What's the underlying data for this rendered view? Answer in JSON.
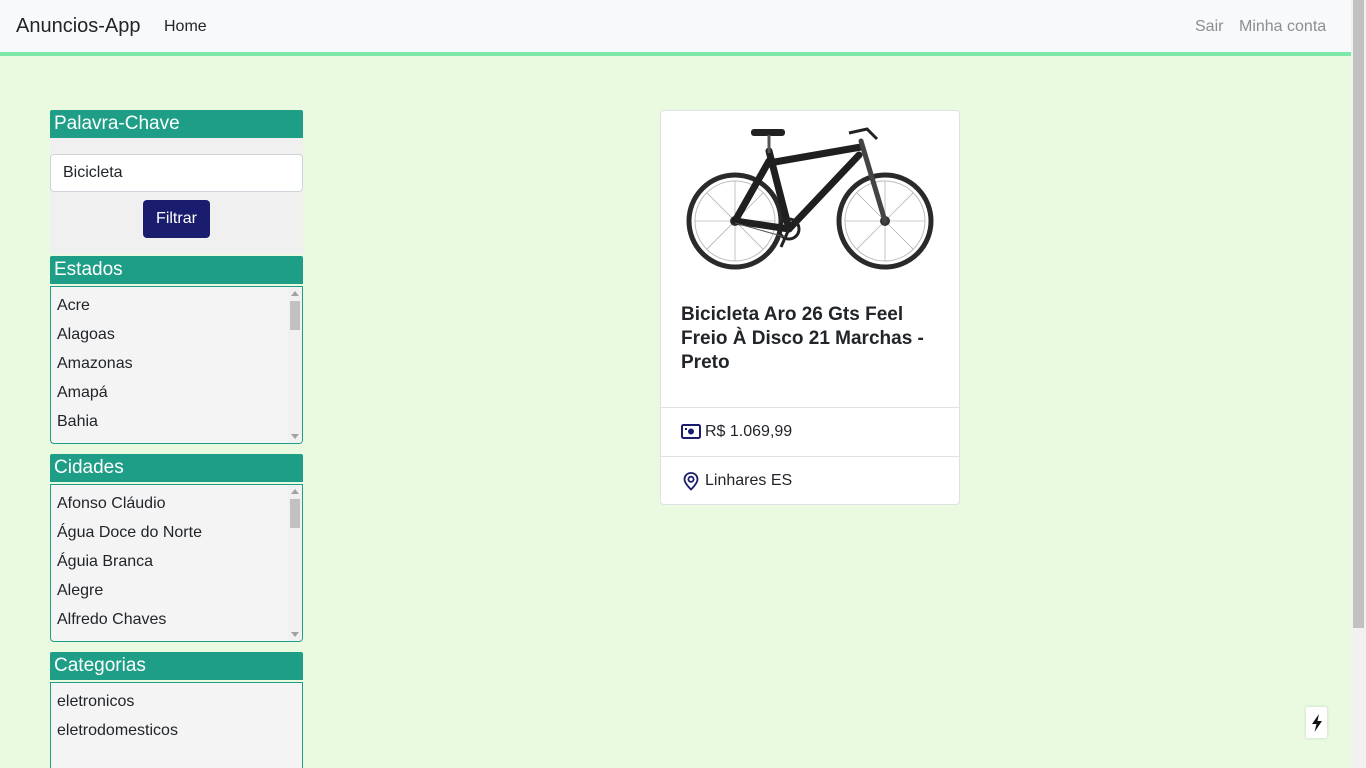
{
  "navbar": {
    "brand": "Anuncios-App",
    "home": "Home",
    "sair": "Sair",
    "minha_conta": "Minha conta"
  },
  "sidebar": {
    "keyword": {
      "header": "Palavra-Chave",
      "input_value": "Bicicleta",
      "button": "Filtrar"
    },
    "estados": {
      "header": "Estados",
      "options": [
        "Acre",
        "Alagoas",
        "Amazonas",
        "Amapá",
        "Bahia"
      ]
    },
    "cidades": {
      "header": "Cidades",
      "options": [
        "Afonso Cláudio",
        "Água Doce do Norte",
        "Águia Branca",
        "Alegre",
        "Alfredo Chaves"
      ]
    },
    "categorias": {
      "header": "Categorias",
      "options": [
        "eletronicos",
        "eletrodomesticos"
      ]
    }
  },
  "listing": {
    "title": "Bicicleta Aro 26 Gts Feel Freio À Disco 21 Marchas - Preto",
    "price": "R$ 1.069,99",
    "location": "Linhares ES"
  },
  "colors": {
    "section_header": "#1e9e86",
    "button": "#1a1d6e",
    "background": "#eafae0",
    "navbar_accent": "#7ee8a8"
  }
}
